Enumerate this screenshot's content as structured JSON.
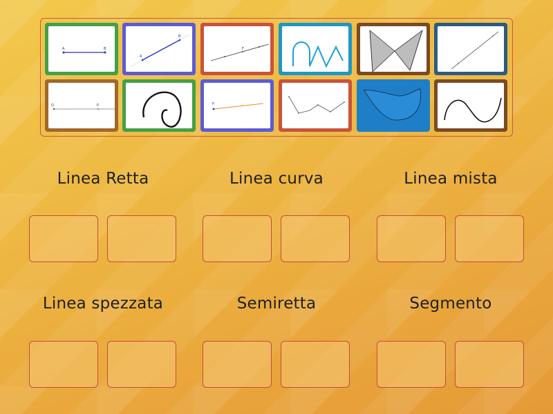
{
  "cards": [
    {
      "id": "segment-ab",
      "frame": "#43a047",
      "icon": "segment-ab-icon",
      "labels": [
        "A",
        "B"
      ]
    },
    {
      "id": "ray-ab-blue",
      "frame": "#5c5bd6",
      "icon": "blue-ray-icon",
      "labels": [
        "A",
        "B"
      ]
    },
    {
      "id": "line-gray",
      "frame": "#c9533a",
      "icon": "line-through-points-icon",
      "labels": [
        "F"
      ]
    },
    {
      "id": "wave-mixed",
      "frame": "#1e96c8",
      "icon": "mixed-wave-icon",
      "labels": []
    },
    {
      "id": "bowtie",
      "frame": "#7b4a22",
      "icon": "bowtie-polygon-icon",
      "labels": []
    },
    {
      "id": "diagonal-line",
      "frame": "#2d5b80",
      "icon": "diagonal-line-icon",
      "labels": []
    },
    {
      "id": "ray-o",
      "frame": "#a0682c",
      "icon": "horizontal-ray-icon",
      "labels": [
        "O",
        "P"
      ]
    },
    {
      "id": "loop-curve",
      "frame": "#43a047",
      "icon": "loop-curve-icon",
      "labels": []
    },
    {
      "id": "orange-ray",
      "frame": "#5c5bd6",
      "icon": "orange-ray-icon",
      "labels": [
        "P"
      ]
    },
    {
      "id": "zigzag",
      "frame": "#c9533a",
      "icon": "zigzag-line-icon",
      "labels": []
    },
    {
      "id": "blue-shape",
      "frame": "#1e7fc8",
      "icon": "curved-blue-shape-icon",
      "labels": [],
      "full": true
    },
    {
      "id": "s-curve",
      "frame": "#7b4a22",
      "icon": "s-curve-icon",
      "labels": []
    }
  ],
  "categories": [
    {
      "title": "Linea Retta"
    },
    {
      "title": "Linea curva"
    },
    {
      "title": "Linea mista"
    },
    {
      "title": "Linea spezzata"
    },
    {
      "title": "Semiretta"
    },
    {
      "title": "Segmento"
    }
  ]
}
